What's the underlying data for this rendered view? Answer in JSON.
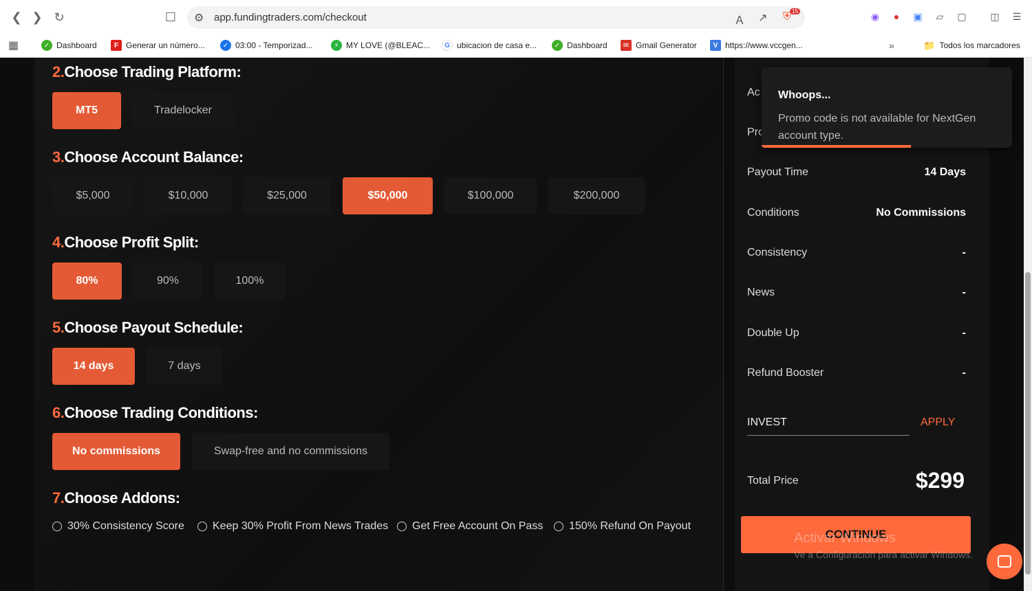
{
  "browser": {
    "url": "app.fundingtraders.com/checkout",
    "ext_badge": "15",
    "bookmarks": [
      {
        "label": "Dashboard",
        "icon_color": "#3fae29"
      },
      {
        "label": "Generar un número...",
        "icon_color": "#e0201b"
      },
      {
        "label": "03:00 - Temporizad...",
        "icon_color": "#1a73e8"
      },
      {
        "label": "MY LOVE (@BLEAC...",
        "icon_color": "#27b33c"
      },
      {
        "label": "ubicacion de casa e...",
        "icon_color": "#4285f4"
      },
      {
        "label": "Dashboard",
        "icon_color": "#3fae29"
      },
      {
        "label": "Gmail Generator",
        "icon_color": "#d93025"
      },
      {
        "label": "https://www.vccgen...",
        "icon_color": "#3d7be0"
      }
    ],
    "all_bookmarks": "Todos los marcadores"
  },
  "steps": {
    "platform": {
      "num": "2.",
      "title": "Choose Trading Platform:",
      "options": [
        "MT5",
        "Tradelocker"
      ],
      "selected": 0
    },
    "balance": {
      "num": "3.",
      "title": "Choose Account Balance:",
      "options": [
        "$5,000",
        "$10,000",
        "$25,000",
        "$50,000",
        "$100,000",
        "$200,000"
      ],
      "selected": 3
    },
    "split": {
      "num": "4.",
      "title": "Choose Profit Split:",
      "options": [
        "80%",
        "90%",
        "100%"
      ],
      "selected": 0
    },
    "payout": {
      "num": "5.",
      "title": "Choose Payout Schedule:",
      "options": [
        "14 days",
        "7 days"
      ],
      "selected": 0
    },
    "conditions": {
      "num": "6.",
      "title": "Choose Trading Conditions:",
      "options": [
        "No commissions",
        "Swap-free and no commissions"
      ],
      "selected": 0
    },
    "addons": {
      "num": "7.",
      "title": "Choose Addons:",
      "options": [
        "30% Consistency Score",
        "Keep 30% Profit From News Trades",
        "Get Free Account On Pass",
        "150% Refund On Payout"
      ]
    }
  },
  "summary": {
    "cut_labels": [
      "Ac",
      "Pro"
    ],
    "rows": [
      {
        "label": "Payout Time",
        "value": "14 Days"
      },
      {
        "label": "Conditions",
        "value": "No Commissions"
      },
      {
        "label": "Consistency",
        "value": "-"
      },
      {
        "label": "News",
        "value": "-"
      },
      {
        "label": "Double Up",
        "value": "-"
      },
      {
        "label": "Refund Booster",
        "value": "-"
      }
    ],
    "promo_value": "INVEST",
    "apply_label": "APPLY",
    "total_label": "Total Price",
    "total_value": "$299",
    "continue_label": "CONTINUE"
  },
  "toast": {
    "title": "Whoops...",
    "message": "Promo code is not available for NextGen account type."
  },
  "watermark": {
    "line1": "Activar Windows",
    "line2": "Ve a Configuración para activar Windows."
  },
  "colors": {
    "accent": "#ff6a3d",
    "selected": "#e45a35"
  }
}
